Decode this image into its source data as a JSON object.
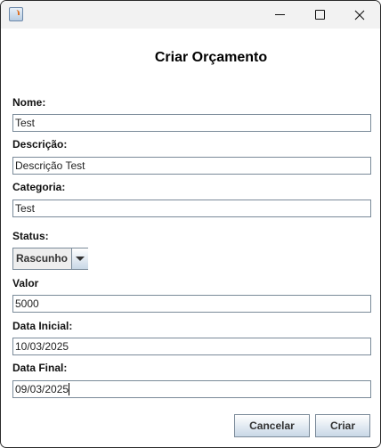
{
  "window": {
    "title_icon": "java-cup-icon"
  },
  "header": {
    "title": "Criar Orçamento"
  },
  "form": {
    "nome": {
      "label": "Nome:",
      "value": "Test"
    },
    "descricao": {
      "label": "Descrição:",
      "value": "Descrição Test"
    },
    "categoria": {
      "label": "Categoria:",
      "value": "Test"
    },
    "status": {
      "label": "Status:",
      "value": "Rascunho"
    },
    "valor": {
      "label": "Valor",
      "value": "5000"
    },
    "data_inicial": {
      "label": "Data Inicial:",
      "value": "10/03/2025"
    },
    "data_final": {
      "label": "Data Final:",
      "value": "09/03/2025"
    }
  },
  "buttons": {
    "cancel": "Cancelar",
    "create": "Criar"
  }
}
